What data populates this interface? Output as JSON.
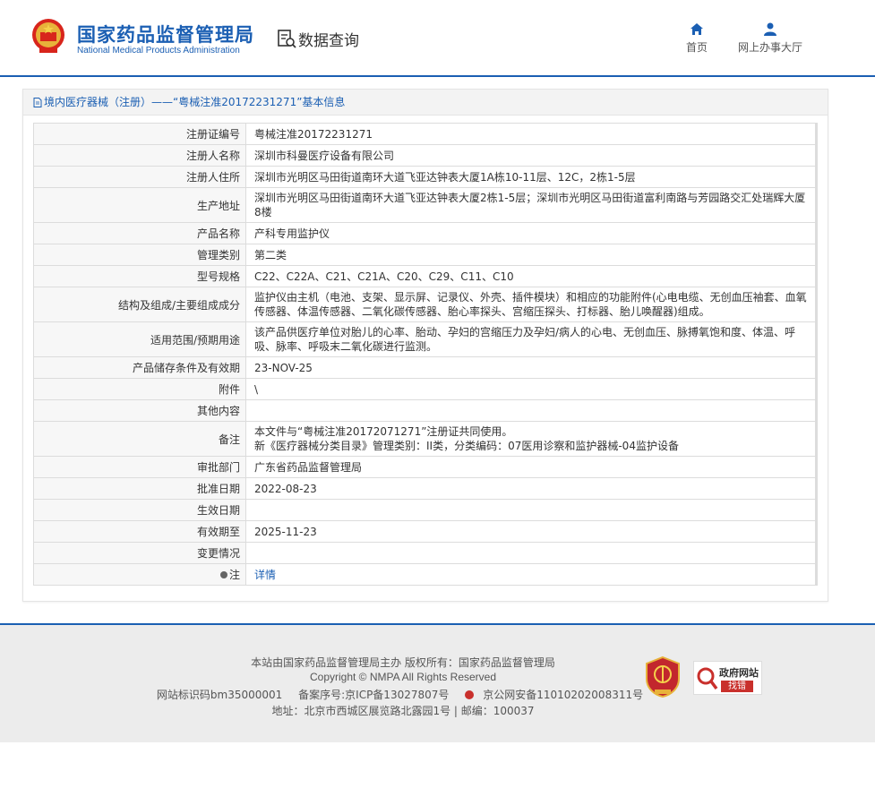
{
  "header": {
    "logo_cn": "国家药品监督管理局",
    "logo_en": "National Medical Products Administration",
    "query_label": "数据查询",
    "nav": [
      {
        "label": "首页",
        "icon": "home-icon"
      },
      {
        "label": "网上办事大厅",
        "icon": "user-icon"
      }
    ]
  },
  "panel": {
    "title": "境内医疗器械（注册）——“粤械注准20172231271”基本信息",
    "rows": [
      {
        "label": "注册证编号",
        "value": "粤械注准20172231271"
      },
      {
        "label": "注册人名称",
        "value": "深圳市科曼医疗设备有限公司"
      },
      {
        "label": "注册人住所",
        "value": "深圳市光明区马田街道南环大道飞亚达钟表大厦1A栋10-11层、12C，2栋1-5层"
      },
      {
        "label": "生产地址",
        "value": "深圳市光明区马田街道南环大道飞亚达钟表大厦2栋1-5层；深圳市光明区马田街道富利南路与芳园路交汇处瑞辉大厦8楼"
      },
      {
        "label": "产品名称",
        "value": "产科专用监护仪"
      },
      {
        "label": "管理类别",
        "value": "第二类"
      },
      {
        "label": "型号规格",
        "value": "C22、C22A、C21、C21A、C20、C29、C11、C10"
      },
      {
        "label": "结构及组成/主要组成成分",
        "value": "监护仪由主机（电池、支架、显示屏、记录仪、外壳、插件模块）和相应的功能附件(心电电缆、无创血压袖套、血氧传感器、体温传感器、二氧化碳传感器、胎心率探头、宫缩压探头、打标器、胎儿唤醒器)组成。"
      },
      {
        "label": "适用范围/预期用途",
        "value": "该产品供医疗单位对胎儿的心率、胎动、孕妇的宫缩压力及孕妇/病人的心电、无创血压、脉搏氧饱和度、体温、呼吸、脉率、呼吸末二氧化碳进行监测。"
      },
      {
        "label": "产品储存条件及有效期",
        "value": "23-NOV-25"
      },
      {
        "label": "附件",
        "value": "\\"
      },
      {
        "label": "其他内容",
        "value": ""
      },
      {
        "label": "备注",
        "value_lines": [
          "本文件与“粤械注准20172071271”注册证共同使用。",
          "新《医疗器械分类目录》管理类别：II类，分类编码：07医用诊察和监护器械-04监护设备"
        ]
      },
      {
        "label": "审批部门",
        "value": "广东省药品监督管理局"
      },
      {
        "label": "批准日期",
        "value": "2022-08-23"
      },
      {
        "label": "生效日期",
        "value": ""
      },
      {
        "label": "有效期至",
        "value": "2025-11-23"
      },
      {
        "label": "变更情况",
        "value": ""
      },
      {
        "label": "注",
        "value": "详情"
      }
    ]
  },
  "footer": {
    "line1": "本站由国家药品监督管理局主办 版权所有：国家药品监督管理局",
    "line2": "Copyright © NMPA All Rights Reserved",
    "site_id": "网站标识码bm35000001",
    "icp": "备案序号:京ICP备13027807号",
    "police": "京公网安备11010202008311号",
    "address": "地址：北京市西城区展览路北露园1号 | 邮编：100037",
    "badge_gov_1": "政府网站",
    "badge_gov_2": "找错"
  },
  "colors": {
    "brand": "#1b5fb3",
    "alert": "#c9302c"
  }
}
